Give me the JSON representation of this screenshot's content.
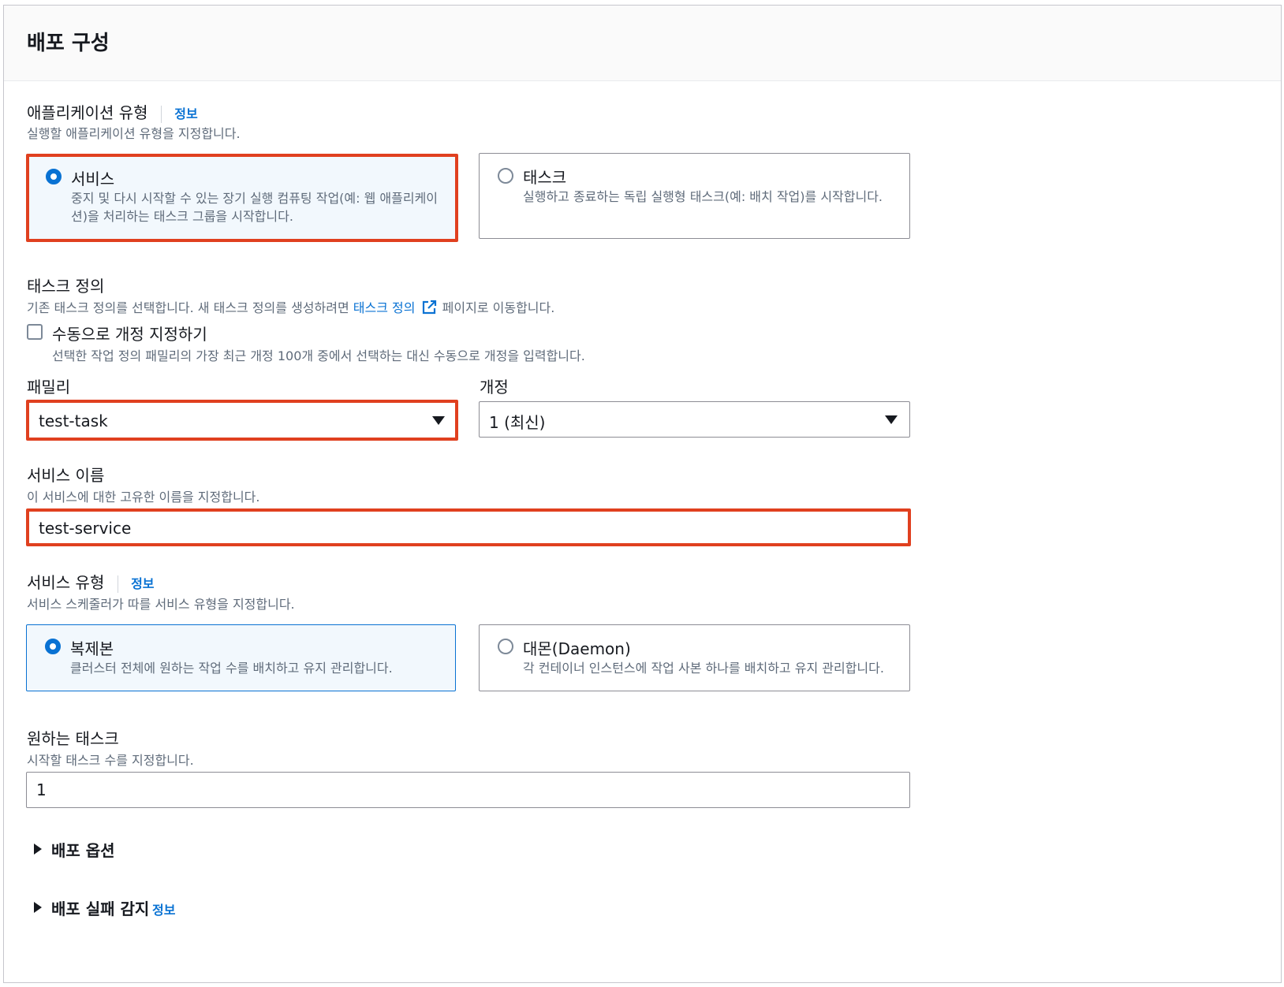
{
  "section": {
    "title": "배포 구성"
  },
  "app_type": {
    "label": "애플리케이션 유형",
    "info": "정보",
    "description": "실행할 애플리케이션 유형을 지정합니다.",
    "options": [
      {
        "title": "서비스",
        "desc_line1": "중지 및 다시 시작할 수 있는 장기 실행 컴퓨팅 작업(예: 웹 애플리케이",
        "desc_line2": "션)을 처리하는 태스크 그룹을 시작합니다.",
        "selected": true
      },
      {
        "title": "태스크",
        "desc_line1": "실행하고 종료하는 독립 실행형 태스크(예: 배치 작업)를 시작합니다.",
        "selected": false
      }
    ]
  },
  "task_def": {
    "label": "태스크 정의",
    "desc_prefix": "기존 태스크 정의를 선택합니다. 새 태스크 정의를 생성하려면",
    "desc_link": "태스크 정의",
    "desc_suffix": "페이지로 이동합니다.",
    "manual_revision": {
      "label": "수동으로 개정 지정하기",
      "desc": "선택한 작업 정의 패밀리의 가장 최근 개정 100개 중에서 선택하는 대신 수동으로 개정을 입력합니다.",
      "checked": false
    },
    "family": {
      "label": "패밀리",
      "value": "test-task"
    },
    "revision": {
      "label": "개정",
      "value": "1 (최신)"
    }
  },
  "service_name": {
    "label": "서비스 이름",
    "description": "이 서비스에 대한 고유한 이름을 지정합니다.",
    "value": "test-service"
  },
  "service_type": {
    "label": "서비스 유형",
    "info": "정보",
    "description": "서비스 스케줄러가 따를 서비스 유형을 지정합니다.",
    "options": [
      {
        "title": "복제본",
        "desc": "클러스터 전체에 원하는 작업 수를 배치하고 유지 관리합니다.",
        "selected": true
      },
      {
        "title": "대몬(Daemon)",
        "desc": "각 컨테이너 인스턴스에 작업 사본 하나를 배치하고 유지 관리합니다.",
        "selected": false
      }
    ]
  },
  "desired_tasks": {
    "label": "원하는 태스크",
    "description": "시작할 태스크 수를 지정합니다.",
    "value": "1"
  },
  "expanders": {
    "deploy_options": {
      "label": "배포 옵션"
    },
    "failure_detection": {
      "label": "배포 실패 감지",
      "info": "정보"
    }
  },
  "colors": {
    "accent": "#0972d3",
    "highlight": "#e0401f",
    "selected_bg": "#f2f8fd"
  },
  "icons": [
    "external-link-icon",
    "caret-down-icon",
    "caret-right-icon"
  ]
}
